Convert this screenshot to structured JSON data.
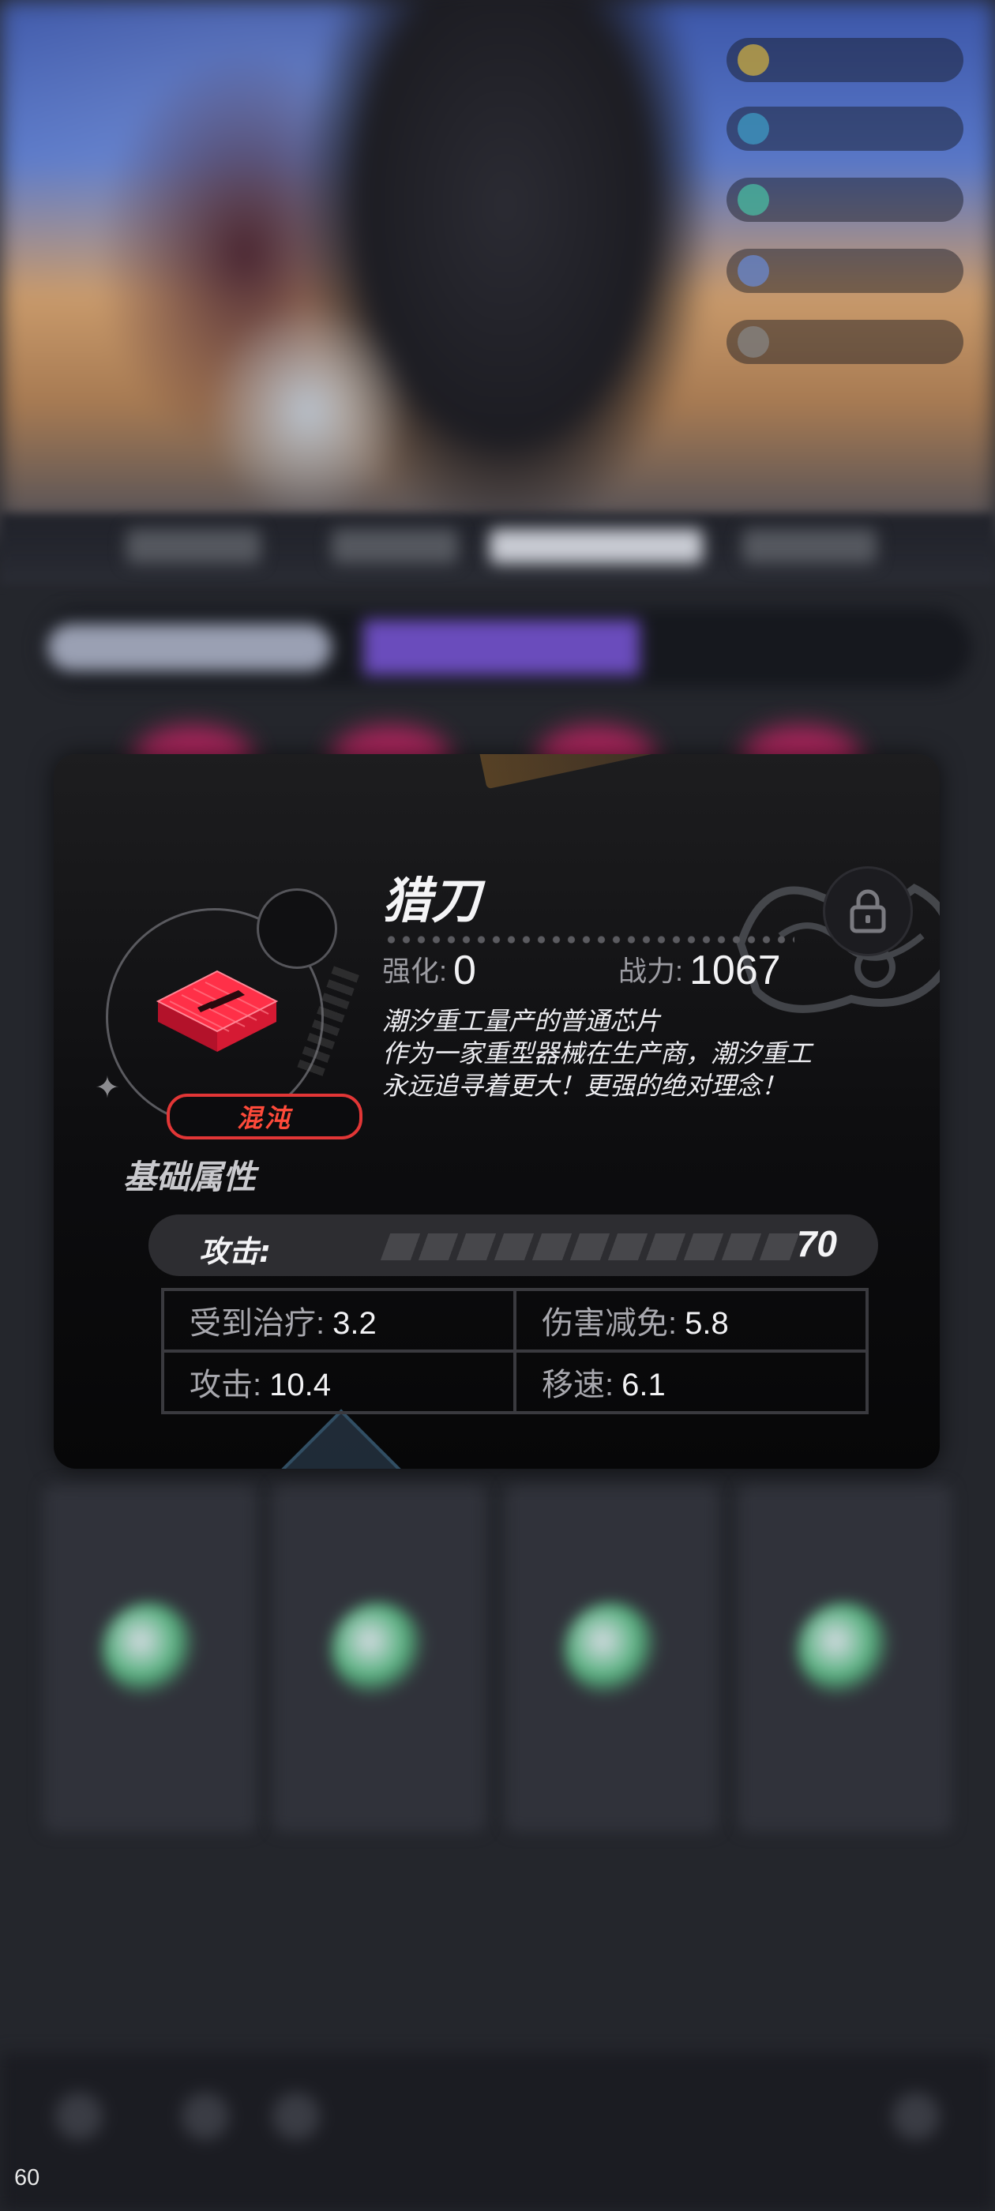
{
  "overlay": {
    "fps": "60"
  },
  "item": {
    "name": "猎刀",
    "rarity": "混沌",
    "enhance_label": "强化:",
    "enhance_value": "0",
    "power_label": "战力:",
    "power_value": "1067",
    "description": [
      "潮汐重工量产的普通芯片",
      "作为一家重型器械在生产商，潮汐重工",
      "永远追寻着更大！更强的绝对理念！"
    ]
  },
  "attributes": {
    "section_title": "基础属性",
    "main": {
      "label": "攻击:",
      "value": "70"
    },
    "sub": [
      [
        {
          "label": "受到治疗:",
          "value": "3.2"
        },
        {
          "label": "伤害减免:",
          "value": "5.8"
        }
      ],
      [
        {
          "label": "攻击:",
          "value": "10.4"
        },
        {
          "label": "移速:",
          "value": "6.1"
        }
      ]
    ]
  },
  "colors": {
    "rarity_red": "#e23636",
    "chip_red": "#e8213a",
    "card_bg": "#0d0d0f"
  },
  "icons": [
    "chip-icon",
    "lock-icon",
    "sparkle-icon"
  ]
}
